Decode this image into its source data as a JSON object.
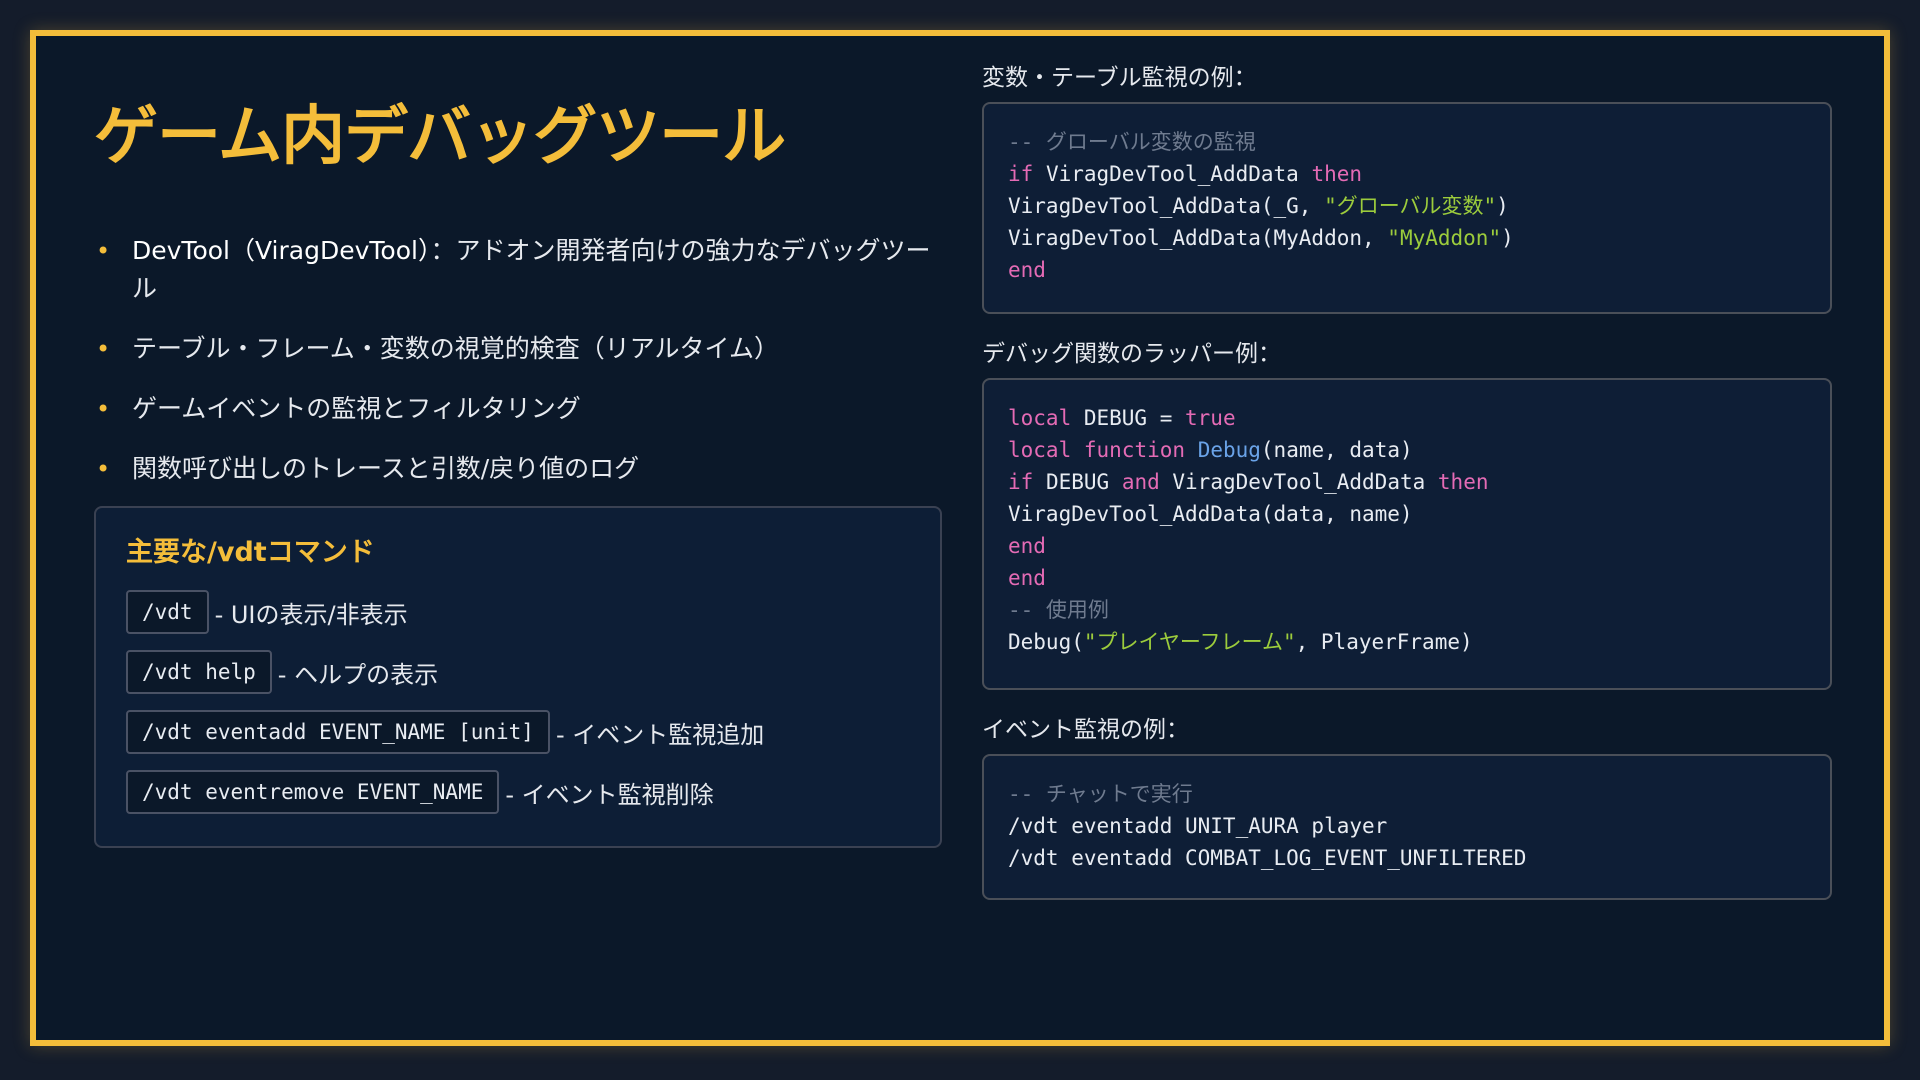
{
  "title": "ゲーム内デバッグツール",
  "bullets": [
    {
      "lead": "DevTool（ViragDevTool）",
      "text": "：アドオン開発者向けの強力なデバッグツール"
    },
    {
      "lead": "",
      "text": "テーブル・フレーム・変数の視覚的検査（リアルタイム）"
    },
    {
      "lead": "",
      "text": "ゲームイベントの監視とフィルタリング"
    },
    {
      "lead": "",
      "text": "関数呼び出しのトレースと引数/戻り値のログ"
    }
  ],
  "commands": {
    "heading": "主要な/vdtコマンド",
    "items": [
      {
        "code": "/vdt",
        "desc": "- UIの表示/非表示"
      },
      {
        "code": "/vdt help",
        "desc": "- ヘルプの表示"
      },
      {
        "code": "/vdt eventadd EVENT_NAME [unit]",
        "desc": "- イベント監視追加"
      },
      {
        "code": "/vdt eventremove EVENT_NAME",
        "desc": "- イベント監視削除"
      }
    ]
  },
  "examples": [
    {
      "label": "変数・テーブル監視の例：",
      "lines": [
        [
          {
            "t": "-- グローバル変数の監視",
            "c": "comment"
          }
        ],
        [
          {
            "t": "if",
            "c": "kw"
          },
          {
            "t": " ViragDevTool_AddData ",
            "c": "plain"
          },
          {
            "t": "then",
            "c": "kw"
          }
        ],
        [
          {
            "t": "ViragDevTool_AddData(_G, ",
            "c": "plain"
          },
          {
            "t": "\"グローバル変数\"",
            "c": "str"
          },
          {
            "t": ")",
            "c": "plain"
          }
        ],
        [
          {
            "t": "ViragDevTool_AddData(MyAddon, ",
            "c": "plain"
          },
          {
            "t": "\"MyAddon\"",
            "c": "str"
          },
          {
            "t": ")",
            "c": "plain"
          }
        ],
        [
          {
            "t": "end",
            "c": "kw"
          }
        ]
      ]
    },
    {
      "label": "デバッグ関数のラッパー例：",
      "lines": [
        [
          {
            "t": "local",
            "c": "kw"
          },
          {
            "t": " DEBUG = ",
            "c": "plain"
          },
          {
            "t": "true",
            "c": "kw"
          }
        ],
        [
          {
            "t": "local",
            "c": "kw"
          },
          {
            "t": " ",
            "c": "plain"
          },
          {
            "t": "function",
            "c": "kw"
          },
          {
            "t": " ",
            "c": "plain"
          },
          {
            "t": "Debug",
            "c": "fn"
          },
          {
            "t": "(name, data)",
            "c": "plain"
          }
        ],
        [
          {
            "t": "if",
            "c": "kw"
          },
          {
            "t": " DEBUG ",
            "c": "plain"
          },
          {
            "t": "and",
            "c": "kw"
          },
          {
            "t": " ViragDevTool_AddData ",
            "c": "plain"
          },
          {
            "t": "then",
            "c": "kw"
          }
        ],
        [
          {
            "t": "ViragDevTool_AddData(data, name)",
            "c": "plain"
          }
        ],
        [
          {
            "t": "end",
            "c": "kw"
          }
        ],
        [
          {
            "t": "end",
            "c": "kw"
          }
        ],
        [
          {
            "t": "-- 使用例",
            "c": "comment"
          }
        ],
        [
          {
            "t": "Debug(",
            "c": "plain"
          },
          {
            "t": "\"プレイヤーフレーム\"",
            "c": "str"
          },
          {
            "t": ", PlayerFrame)",
            "c": "plain"
          }
        ]
      ]
    },
    {
      "label": "イベント監視の例：",
      "lines": [
        [
          {
            "t": "-- チャットで実行",
            "c": "comment"
          }
        ],
        [
          {
            "t": "/vdt eventadd UNIT_AURA player",
            "c": "plain"
          }
        ],
        [
          {
            "t": "/vdt eventadd COMBAT_LOG_EVENT_UNFILTERED",
            "c": "plain"
          }
        ]
      ]
    }
  ],
  "colors": {
    "accent": "#f4bd3a",
    "background": "#0b1829",
    "keyword": "#e46bb5",
    "string": "#9ccc3c",
    "function": "#6aa3e8",
    "comment": "#6f7b8f"
  }
}
